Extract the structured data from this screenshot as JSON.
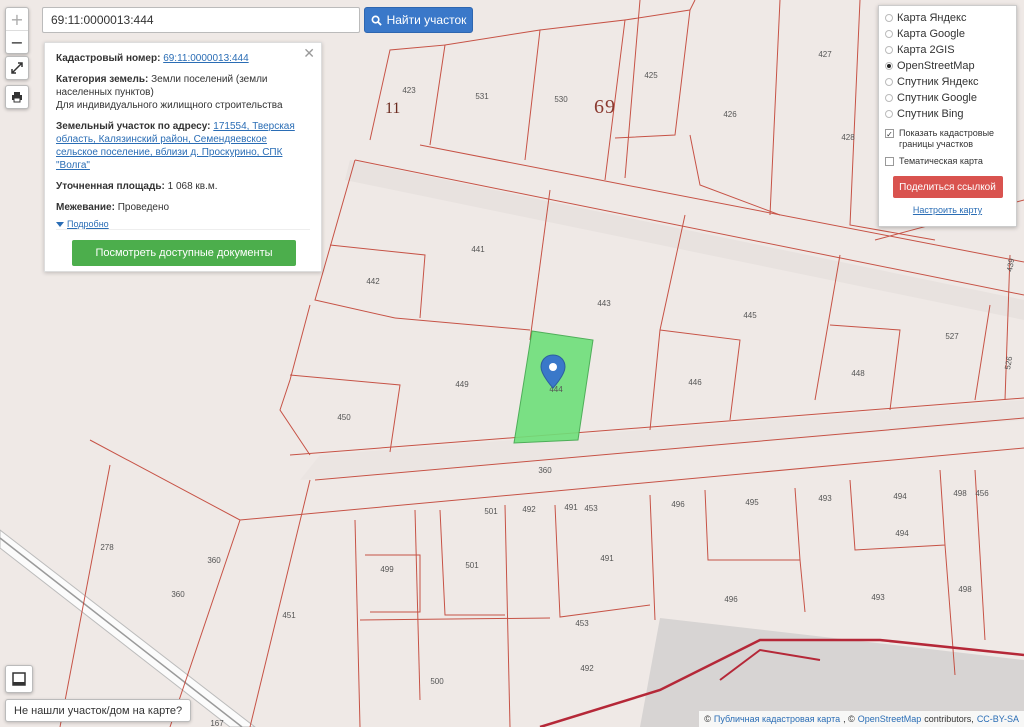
{
  "search": {
    "value": "69:11:0000013:444",
    "button_label": "Найти участок"
  },
  "controls": {
    "zoom_in": "+",
    "zoom_out": "−"
  },
  "info": {
    "close": "✕",
    "cadastral_label": "Кадастровый номер:",
    "cadastral_value": "69:11:0000013:444",
    "category_label": "Категория земель:",
    "category_value": "Земли поселений (земли населенных пунктов)",
    "usage_value": "Для индивидуального жилищного строительства",
    "address_label": "Земельный участок по адресу:",
    "address_value": "171554, Тверская область, Калязинский район, Семендяевское сельское поселение, вблизи д. Проскурино, СПК \"Волга\"",
    "area_label": "Уточненная площадь:",
    "area_value": "1 068 кв.м.",
    "survey_label": "Межевание:",
    "survey_value": "Проведено",
    "details_link": "Подробно",
    "docs_button": "Посмотреть доступные документы"
  },
  "layers": {
    "options": [
      "Карта Яндекс",
      "Карта Google",
      "Карта 2GIS",
      "OpenStreetMap",
      "Спутник Яндекс",
      "Спутник Google",
      "Спутник Bing"
    ],
    "selected": "OpenStreetMap",
    "show_borders": "Показать кадастровые границы участков",
    "thematic": "Тематическая карта",
    "share_button": "Поделиться ссылкой",
    "configure_link": "Настроить карту"
  },
  "bottom": {
    "not_found": "Не нашли участок/дом на карте?",
    "attr_copy": "©",
    "attr_pkk": "Публичная кадастровая карта",
    "attr_sep": ", ©",
    "attr_osm": "OpenStreetMap",
    "attr_contrib": "contributors,",
    "attr_license": "CC-BY-SA"
  },
  "map": {
    "zones": [
      "11",
      "69"
    ],
    "plots": [
      "423",
      "531",
      "530",
      "425",
      "427",
      "426",
      "428",
      "441",
      "442",
      "443",
      "445",
      "527",
      "449",
      "446",
      "448",
      "450",
      "444",
      "360",
      "501",
      "492",
      "491",
      "453",
      "496",
      "495",
      "493",
      "494",
      "498",
      "456",
      "278",
      "360",
      "499",
      "501",
      "491",
      "494",
      "496",
      "493",
      "498",
      "451",
      "453",
      "492",
      "500",
      "167",
      "439",
      "526"
    ],
    "colors": {
      "selected_plot": "#6ee07a",
      "boundary": "#c0392b",
      "road": "#e6dfdc",
      "accent": "#3a78c9"
    }
  }
}
